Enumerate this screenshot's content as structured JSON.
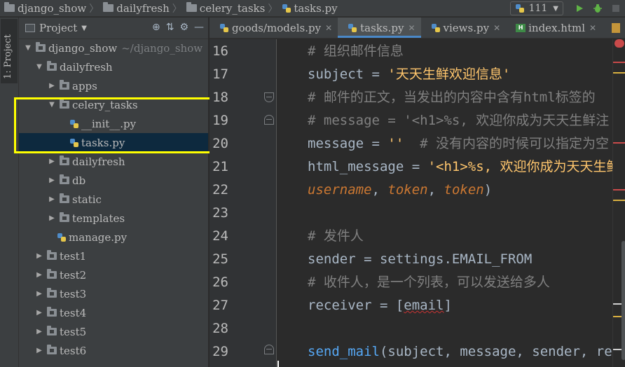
{
  "navbar": {
    "breadcrumbs": [
      "django_show",
      "dailyfresh",
      "celery_tasks",
      "tasks.py"
    ],
    "run_config": "111",
    "icons": [
      "run-icon",
      "debug-icon",
      "stop-icon"
    ]
  },
  "tool_strip": {
    "project_tab": "1: Project"
  },
  "panel": {
    "title": "Project",
    "tree": [
      {
        "label": "django_show",
        "hint": "~/django_show",
        "depth": 0,
        "expanded": true,
        "type": "folder"
      },
      {
        "label": "dailyfresh",
        "depth": 1,
        "expanded": true,
        "type": "folder"
      },
      {
        "label": "apps",
        "depth": 2,
        "expanded": false,
        "type": "folder"
      },
      {
        "label": "celery_tasks",
        "depth": 2,
        "expanded": true,
        "type": "folder"
      },
      {
        "label": "__init__.py",
        "depth": 3,
        "type": "python"
      },
      {
        "label": "tasks.py",
        "depth": 3,
        "type": "python",
        "selected": true
      },
      {
        "label": "dailyfresh",
        "depth": 2,
        "expanded": false,
        "type": "folder"
      },
      {
        "label": "db",
        "depth": 2,
        "expanded": false,
        "type": "folder"
      },
      {
        "label": "static",
        "depth": 2,
        "expanded": false,
        "type": "folder"
      },
      {
        "label": "templates",
        "depth": 2,
        "expanded": false,
        "type": "folder"
      },
      {
        "label": "manage.py",
        "depth": 2,
        "type": "python"
      },
      {
        "label": "test1",
        "depth": 1,
        "expanded": false,
        "type": "folder"
      },
      {
        "label": "test2",
        "depth": 1,
        "expanded": false,
        "type": "folder"
      },
      {
        "label": "test3",
        "depth": 1,
        "expanded": false,
        "type": "folder"
      },
      {
        "label": "test4",
        "depth": 1,
        "expanded": false,
        "type": "folder"
      },
      {
        "label": "test5",
        "depth": 1,
        "expanded": false,
        "type": "folder"
      },
      {
        "label": "test6",
        "depth": 1,
        "expanded": false,
        "type": "folder"
      }
    ]
  },
  "tabs": [
    {
      "label": "goods/models.py",
      "type": "python",
      "active": false
    },
    {
      "label": "tasks.py",
      "type": "python",
      "active": true
    },
    {
      "label": "views.py",
      "type": "python",
      "active": false
    },
    {
      "label": "index.html",
      "type": "html",
      "active": false
    }
  ],
  "editor": {
    "lines": [
      {
        "n": "16",
        "tokens": [
          {
            "t": "# 组织邮件信息",
            "c": "k-cmt"
          }
        ]
      },
      {
        "n": "17",
        "tokens": [
          {
            "t": "subject = "
          },
          {
            "t": "'天天生鲜欢迎信息'",
            "c": "k-str"
          }
        ]
      },
      {
        "n": "18",
        "tokens": [
          {
            "t": "# 邮件的正文，当发出的内容中含有html标签的",
            "c": "k-cmt"
          }
        ]
      },
      {
        "n": "19",
        "tokens": [
          {
            "t": "# message = '<h1>%s, 欢迎你成为天天生鲜注",
            "c": "k-cmt"
          }
        ]
      },
      {
        "n": "20",
        "tokens": [
          {
            "t": "message = "
          },
          {
            "t": "''",
            "c": "k-str"
          },
          {
            "t": "  # 没有内容的时候可以指定为空",
            "c": "k-cmt"
          }
        ]
      },
      {
        "n": "21",
        "tokens": [
          {
            "t": "html_message = "
          },
          {
            "t": "'<h1>%s, 欢迎你成为天天生鲜",
            "c": "k-str"
          }
        ]
      },
      {
        "n": "22",
        "tokens": [
          {
            "t": "username",
            "c": "k-par"
          },
          {
            "t": ", "
          },
          {
            "t": "token",
            "c": "k-par"
          },
          {
            "t": ", "
          },
          {
            "t": "token",
            "c": "k-par"
          },
          {
            "t": ")"
          }
        ]
      },
      {
        "n": "23",
        "tokens": []
      },
      {
        "n": "24",
        "tokens": [
          {
            "t": "# 发件人",
            "c": "k-cmt"
          }
        ]
      },
      {
        "n": "25",
        "tokens": [
          {
            "t": "sender = settings.EMAIL_FROM"
          }
        ]
      },
      {
        "n": "26",
        "tokens": [
          {
            "t": "# 收件人，是一个列表，可以发送给多人",
            "c": "k-cmt"
          }
        ]
      },
      {
        "n": "27",
        "tokens": [
          {
            "t": "receiver = ["
          },
          {
            "t": "email",
            "c": "k-uw"
          },
          {
            "t": "]"
          }
        ]
      },
      {
        "n": "28",
        "tokens": []
      },
      {
        "n": "29",
        "tokens": [
          {
            "t": "send_mail",
            "c": "k-fn"
          },
          {
            "t": "(subject, message, sender, recei"
          }
        ]
      }
    ]
  },
  "colors": {
    "accent": "#4a88c7",
    "selection": "#0d293e",
    "highlight_box": "#ffff00",
    "comment": "#808080",
    "string": "#ffc66d",
    "param": "#cc7832",
    "function": "#56a8f5"
  }
}
